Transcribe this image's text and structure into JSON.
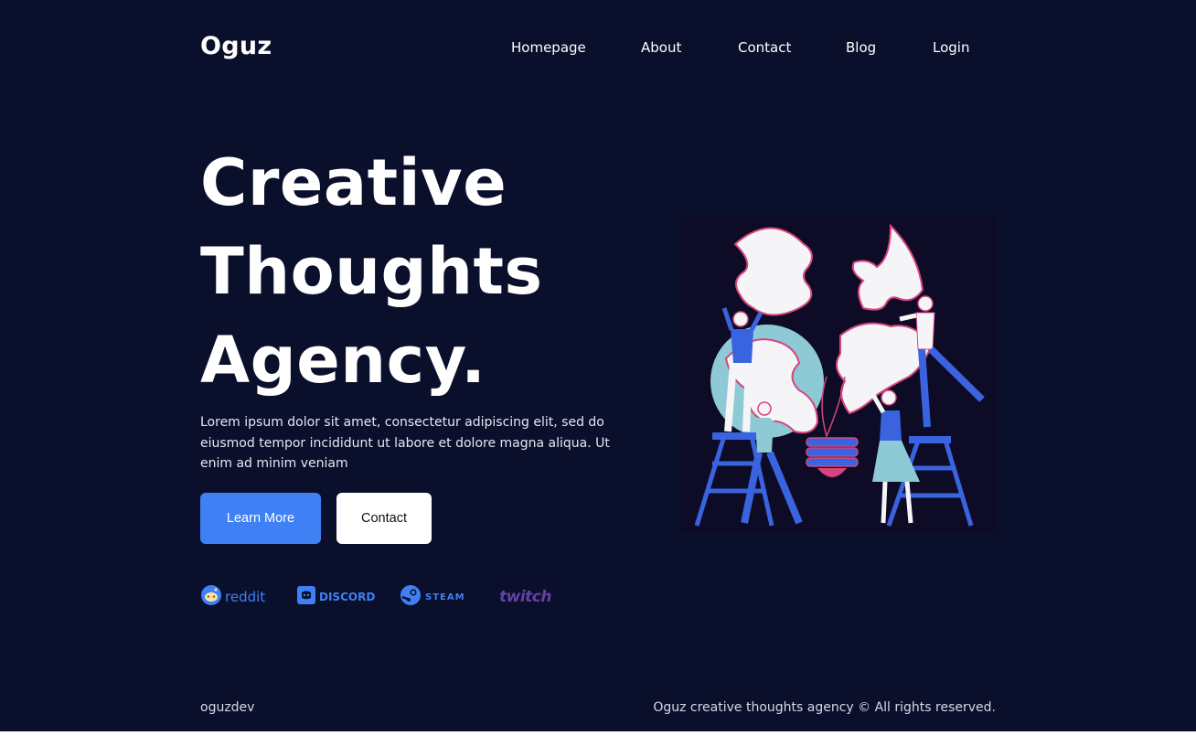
{
  "header": {
    "logo": "Oguz",
    "nav": [
      {
        "label": "Homepage"
      },
      {
        "label": "About"
      },
      {
        "label": "Contact"
      },
      {
        "label": "Blog"
      },
      {
        "label": "Login"
      }
    ]
  },
  "hero": {
    "title_lines": [
      "Creative",
      "Thoughts",
      "Agency."
    ],
    "description": "Lorem ipsum dolor sit amet, consectetur adipiscing elit, sed do eiusmod tempor incididunt ut labore et dolore magna aliqua. Ut enim ad minim veniam",
    "primary_button": "Learn More",
    "secondary_button": "Contact"
  },
  "brands": [
    {
      "icon": "reddit-icon",
      "label": "reddit",
      "color": "#3f80f4"
    },
    {
      "icon": "discord-icon",
      "label": "DISCORD",
      "color": "#3f80f4"
    },
    {
      "icon": "steam-icon",
      "label": "STEAM",
      "color": "#3f80f4"
    },
    {
      "icon": "twitch-icon",
      "label": "twitch",
      "color": "#6441a5"
    }
  ],
  "footer": {
    "left": "oguzdev",
    "right": "Oguz creative thoughts agency © All rights reserved."
  },
  "colors": {
    "background": "#0a0f2b",
    "accent": "#3f80f4",
    "button_secondary": "#ffffff",
    "illustration_pink": "#d6457e",
    "illustration_lightblue": "#8ec9d6"
  }
}
